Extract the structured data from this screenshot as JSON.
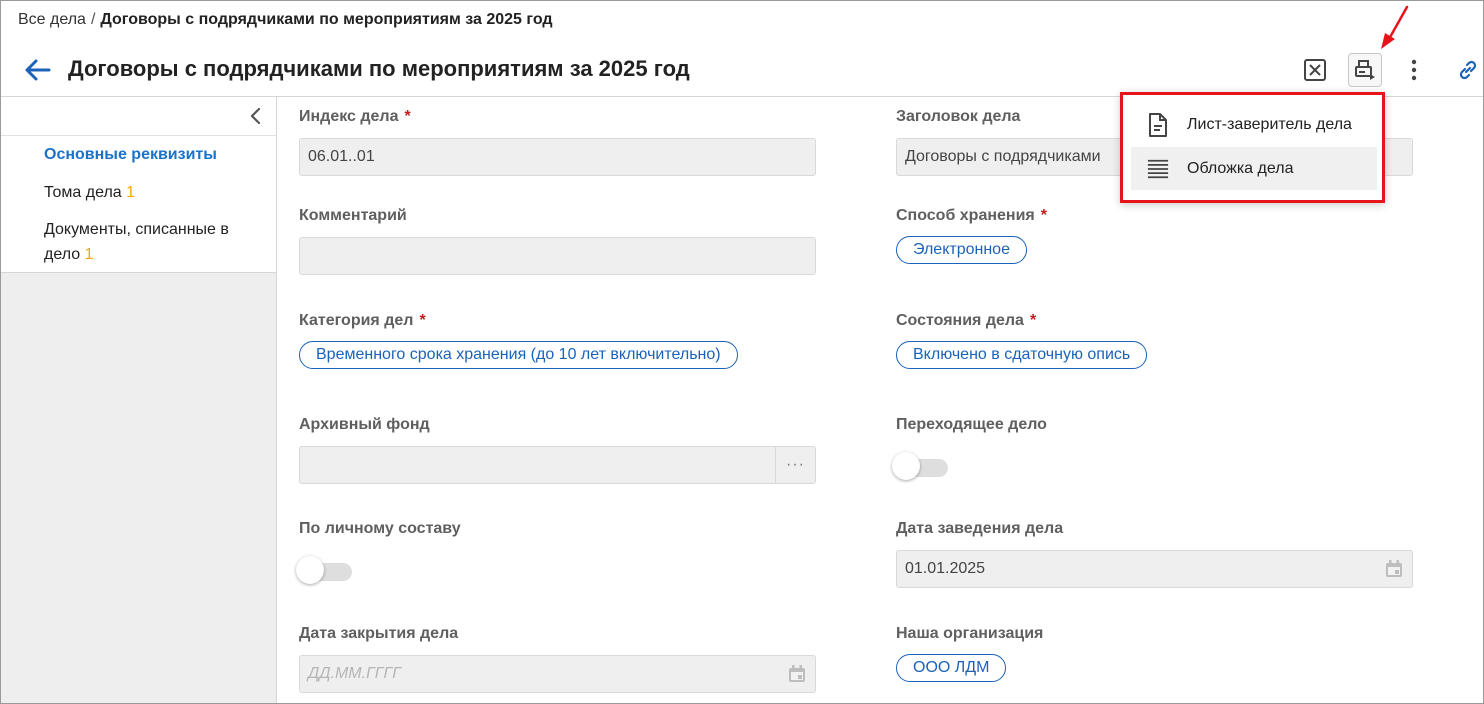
{
  "breadcrumb": {
    "root": "Все дела",
    "separator": "/",
    "current": "Договоры с подрядчиками по мероприятиям за 2025 год"
  },
  "header": {
    "title": "Договоры с подрядчиками по мероприятиям за 2025 год"
  },
  "sidebar": {
    "items": [
      {
        "label": "Основные реквизиты",
        "count": ""
      },
      {
        "label": "Тома дела",
        "count": "1"
      },
      {
        "label_line1": "Документы, списанные в",
        "label_line2": "дело",
        "count": "1"
      }
    ]
  },
  "form": {
    "index": {
      "label": "Индекс дела",
      "required": "*",
      "value": "06.01..01"
    },
    "title": {
      "label": "Заголовок дела",
      "value": "Договоры с подрядчиками"
    },
    "comment": {
      "label": "Комментарий",
      "value": ""
    },
    "storage": {
      "label": "Способ хранения",
      "required": "*",
      "value": "Электронное"
    },
    "category": {
      "label": "Категория дел",
      "required": "*",
      "value": "Временного срока хранения (до 10 лет включительно)"
    },
    "state": {
      "label": "Состояния дела",
      "required": "*",
      "value": "Включено в сдаточную опись"
    },
    "fund": {
      "label": "Архивный фонд",
      "value": "",
      "button": "···"
    },
    "transitional": {
      "label": "Переходящее дело",
      "on": false
    },
    "personnel": {
      "label": "По личному составу",
      "on": false
    },
    "opened": {
      "label": "Дата заведения дела",
      "value": "01.01.2025"
    },
    "closed": {
      "label": "Дата закрытия дела",
      "placeholder": "ДД.ММ.ГГГГ"
    },
    "org": {
      "label": "Наша организация",
      "value": "ООО ЛДМ"
    }
  },
  "print_menu": {
    "items": [
      {
        "label": "Лист-заверитель дела",
        "icon": "document-icon"
      },
      {
        "label": "Обложка дела",
        "icon": "lines-icon"
      }
    ]
  },
  "colors": {
    "accent": "#1a63b8",
    "annotation": "#e8141c",
    "count": "#f0a800",
    "required": "#c21e1e"
  }
}
